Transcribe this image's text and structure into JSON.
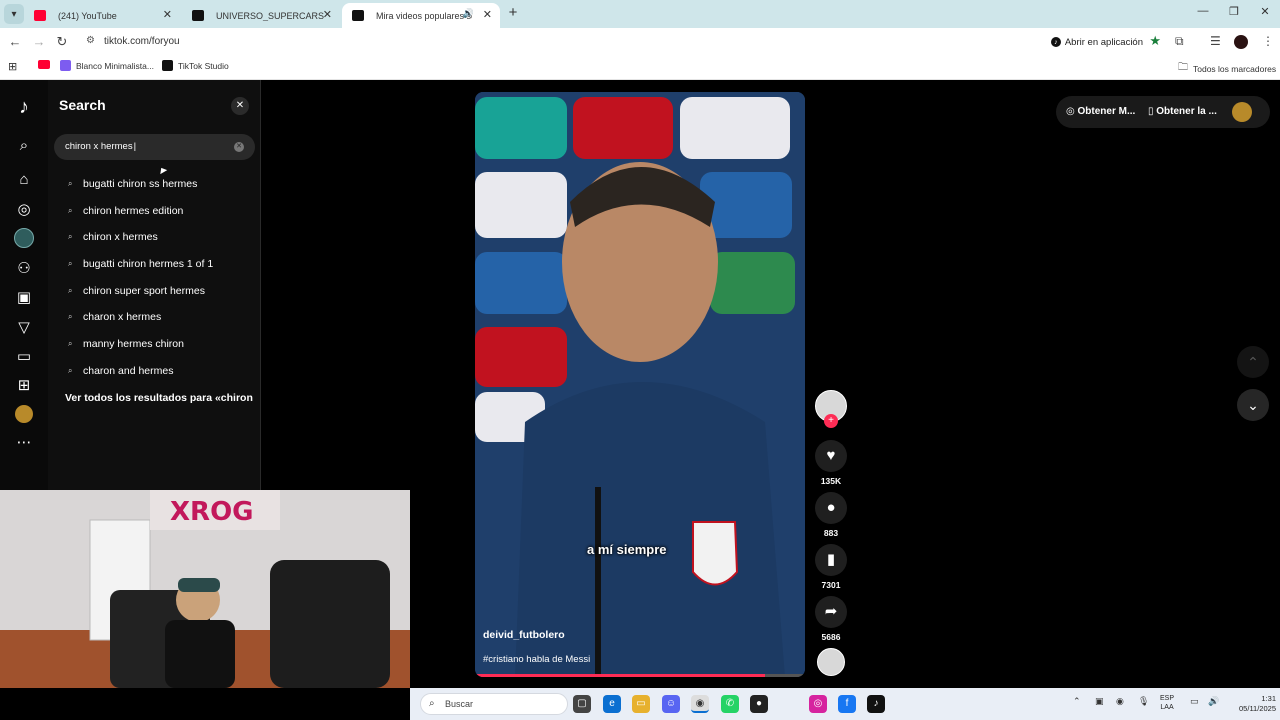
{
  "browser": {
    "tabs": [
      {
        "title": "(241) YouTube",
        "favicon": "youtube-icon",
        "active": false
      },
      {
        "title": "UNIVERSO_SUPERCARS (@universo",
        "favicon": "tiktok-icon",
        "active": false
      },
      {
        "title": "Mira videos populares sele",
        "favicon": "tiktok-icon",
        "active": true
      }
    ],
    "url": "tiktok.com/foryou",
    "open_in_app": "Abrir en aplicación",
    "bookmarks": [
      {
        "label": "",
        "icon": "youtube-icon"
      },
      {
        "label": "Blanco Minimalista...",
        "icon": "canva-icon"
      },
      {
        "label": "TikTok Studio",
        "icon": "tiktok-icon"
      }
    ],
    "all_bookmarks": "Todos los marcadores",
    "colors": {
      "tabstrip": "#cfe6ea",
      "star": "#1a7f3c"
    }
  },
  "search_panel": {
    "title": "Search",
    "query": "chiron x hermes",
    "suggestions": [
      "bugatti chiron ss hermes",
      "chiron hermes edition",
      "chiron x hermes",
      "bugatti chiron hermes 1 of 1",
      "chiron super sport hermes",
      "charon x hermes",
      "manny hermes chiron",
      "charon and hermes"
    ],
    "see_all": "Ver todos los resultados para «chiron x hermes»"
  },
  "video": {
    "author": "deivid_futbolero",
    "hashtag": "#cristiano habla de Messi",
    "caption": "a mí siempre",
    "progress": 0.88,
    "colors": {
      "accent": "#fe2c55"
    }
  },
  "actions": {
    "likes": "135K",
    "comments": "883",
    "saves": "7301",
    "shares": "5686"
  },
  "top_right": {
    "get_m": "Obtener M...",
    "get_app": "Obtener la ..."
  },
  "taskbar": {
    "search": "Buscar",
    "lang_top": "ESP",
    "lang_bottom": "LAA",
    "time": "1:31",
    "date": "05/11/2025"
  }
}
